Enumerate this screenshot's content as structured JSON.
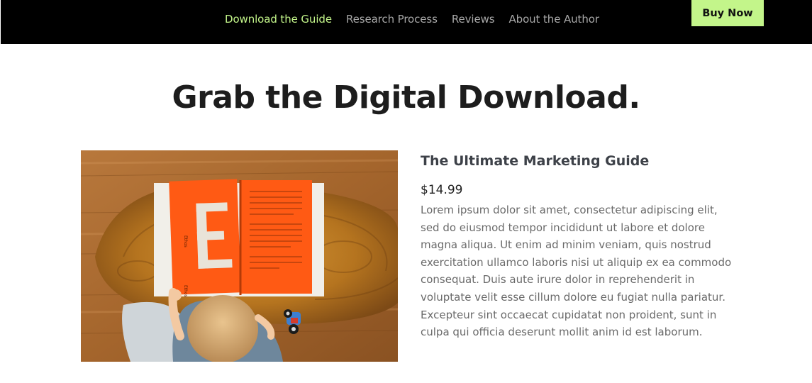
{
  "nav": {
    "links": [
      {
        "label": "Download the Guide",
        "active": true
      },
      {
        "label": "Research Process",
        "active": false
      },
      {
        "label": "Reviews",
        "active": false
      },
      {
        "label": "About the Author",
        "active": false
      }
    ],
    "buy_label": "Buy Now"
  },
  "hero": {
    "headline": "Grab the Digital Download."
  },
  "product": {
    "title": "The Ultimate Marketing Guide",
    "price": "$14.99",
    "description": "Lorem ipsum dolor sit amet, consectetur adipiscing elit, sed do eiusmod tempor incididunt ut labore et dolore magna aliqua. Ut enim ad minim veniam, quis nostrud exercitation ullamco laboris nisi ut aliquip ex ea commodo consequat. Duis aute irure dolor in reprehenderit in voluptate velit esse cillum dolore eu fugiat nulla pariatur. Excepteur sint occaecat cupidatat non proident, sunt in culpa qui officia deserunt mollit anim id est laborum.",
    "image_letter": "E"
  },
  "colors": {
    "accent": "#c3f58a",
    "nav_bg": "#000000",
    "book_orange": "#ff5a14"
  }
}
